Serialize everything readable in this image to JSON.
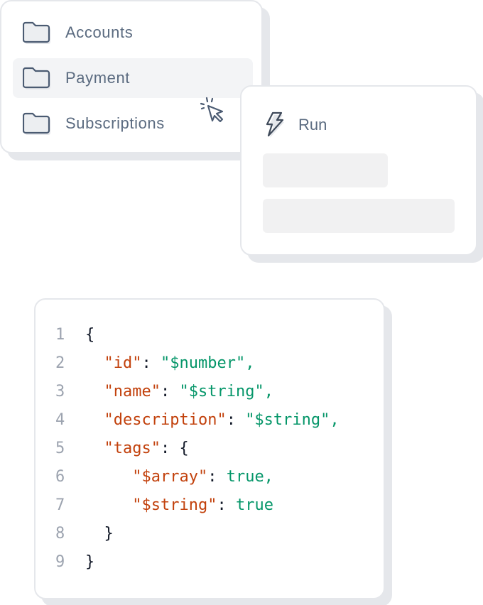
{
  "menu": {
    "items": [
      {
        "label": "Accounts",
        "icon": "folder-icon",
        "active": false
      },
      {
        "label": "Payment",
        "icon": "folder-icon",
        "active": true
      },
      {
        "label": "Subscriptions",
        "icon": "folder-icon",
        "active": false
      }
    ],
    "cursor_icon": "click-cursor-icon"
  },
  "run_card": {
    "icon": "lightning-bolt-icon",
    "label": "Run"
  },
  "code": {
    "lines": [
      {
        "num": "1",
        "tokens": [
          {
            "t": "punct",
            "v": "{"
          }
        ]
      },
      {
        "num": "2",
        "tokens": [
          {
            "t": "punct",
            "v": "  "
          },
          {
            "t": "key",
            "v": "\"id\""
          },
          {
            "t": "punct",
            "v": ": "
          },
          {
            "t": "val",
            "v": "\"$number\","
          }
        ]
      },
      {
        "num": "3",
        "tokens": [
          {
            "t": "punct",
            "v": "  "
          },
          {
            "t": "key",
            "v": "\"name\""
          },
          {
            "t": "punct",
            "v": ": "
          },
          {
            "t": "val",
            "v": "\"$string\","
          }
        ]
      },
      {
        "num": "4",
        "tokens": [
          {
            "t": "punct",
            "v": "  "
          },
          {
            "t": "key",
            "v": "\"description\""
          },
          {
            "t": "punct",
            "v": ": "
          },
          {
            "t": "val",
            "v": "\"$string\","
          }
        ]
      },
      {
        "num": "5",
        "tokens": [
          {
            "t": "punct",
            "v": "  "
          },
          {
            "t": "key",
            "v": "\"tags\""
          },
          {
            "t": "punct",
            "v": ": {"
          }
        ]
      },
      {
        "num": "6",
        "tokens": [
          {
            "t": "punct",
            "v": "     "
          },
          {
            "t": "key",
            "v": "\"$array\""
          },
          {
            "t": "punct",
            "v": ": "
          },
          {
            "t": "val",
            "v": "true,"
          }
        ]
      },
      {
        "num": "7",
        "tokens": [
          {
            "t": "punct",
            "v": "     "
          },
          {
            "t": "key",
            "v": "\"$string\""
          },
          {
            "t": "punct",
            "v": ": "
          },
          {
            "t": "val",
            "v": "true"
          }
        ]
      },
      {
        "num": "8",
        "tokens": [
          {
            "t": "punct",
            "v": "  }"
          }
        ]
      },
      {
        "num": "9",
        "tokens": [
          {
            "t": "punct",
            "v": "}"
          }
        ]
      }
    ]
  }
}
